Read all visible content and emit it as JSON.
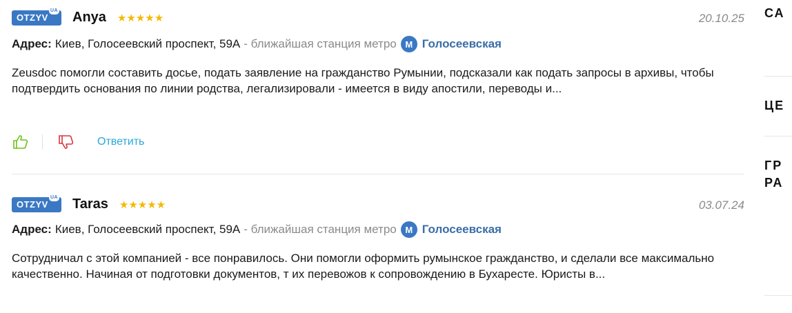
{
  "reviews": [
    {
      "badge": "OTZYV",
      "badge_sup": "UA",
      "author": "Anya",
      "stars": "★★★★★",
      "date": "20.10.25",
      "address_label": "Адрес:",
      "address": "Киев, Голосеевский проспект, 59А",
      "metro_text": "- ближайшая станция метро",
      "metro_icon": "М",
      "station": "Голосеевская",
      "text": "Zeusdoc помогли составить досье, подать заявление на гражданство Румынии, подсказали как подать запросы в архивы, чтобы подтвердить основания по линии родства, легализировали - имеется в виду апостили, переводы и...",
      "reply": "Ответить"
    },
    {
      "badge": "OTZYV",
      "badge_sup": "UA",
      "author": "Taras",
      "stars": "★★★★★",
      "date": "03.07.24",
      "address_label": "Адрес:",
      "address": "Киев, Голосеевский проспект, 59А",
      "metro_text": "- ближайшая станция метро",
      "metro_icon": "М",
      "station": "Голосеевская",
      "text": "Сотрудничал с этой компанией - все понравилось. Они помогли оформить румынское гражданство, и сделали все максимально качественно. Начиная от подготовки документов, т их перевожов к сопровождению в Бухаресте. Юристы в..."
    }
  ],
  "sidebar": {
    "item1": "СА",
    "item2": "ЦЕ",
    "item3a": "ГР",
    "item3b": "РА"
  },
  "colors": {
    "accent": "#3a78c4",
    "star": "#f5b800",
    "like": "#6fbf1a",
    "dislike": "#d9363e",
    "reply": "#29a8d8"
  }
}
